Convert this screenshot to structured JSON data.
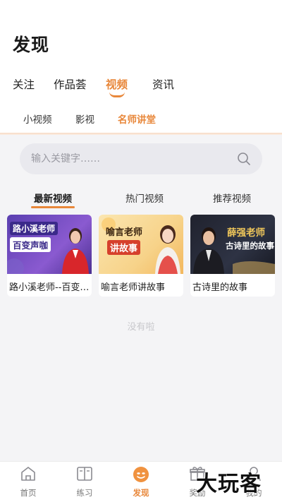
{
  "page": {
    "title": "发现"
  },
  "main_tabs": [
    {
      "label": "关注"
    },
    {
      "label": "作品荟"
    },
    {
      "label": "视频"
    },
    {
      "label": "资讯"
    }
  ],
  "sub_tabs": [
    {
      "label": "小视频"
    },
    {
      "label": "影视"
    },
    {
      "label": "名师讲堂"
    }
  ],
  "search": {
    "placeholder": "输入关键字……"
  },
  "video_tabs": [
    {
      "label": "最新视频"
    },
    {
      "label": "热门视频"
    },
    {
      "label": "推荐视频"
    }
  ],
  "videos": [
    {
      "title": "路小溪老师--百变声咖",
      "thumb_line1": "路小溪老师",
      "thumb_line2": "百变声咖"
    },
    {
      "title": "喻言老师讲故事",
      "thumb_line1": "喻言老师",
      "thumb_line2": "讲故事"
    },
    {
      "title": "古诗里的故事",
      "thumb_line1": "薛强老师",
      "thumb_line2": "古诗里的故事"
    }
  ],
  "empty_text": "没有啦",
  "bottom_nav": [
    {
      "label": "首页",
      "icon": "home-icon"
    },
    {
      "label": "练习",
      "icon": "book-icon"
    },
    {
      "label": "发现",
      "icon": "discover-icon"
    },
    {
      "label": "奖励",
      "icon": "gift-icon"
    },
    {
      "label": "我的",
      "icon": "user-icon"
    }
  ],
  "watermark": "大玩客",
  "colors": {
    "accent": "#e8873a",
    "background": "#f4f4f6",
    "card": "#ffffff"
  }
}
